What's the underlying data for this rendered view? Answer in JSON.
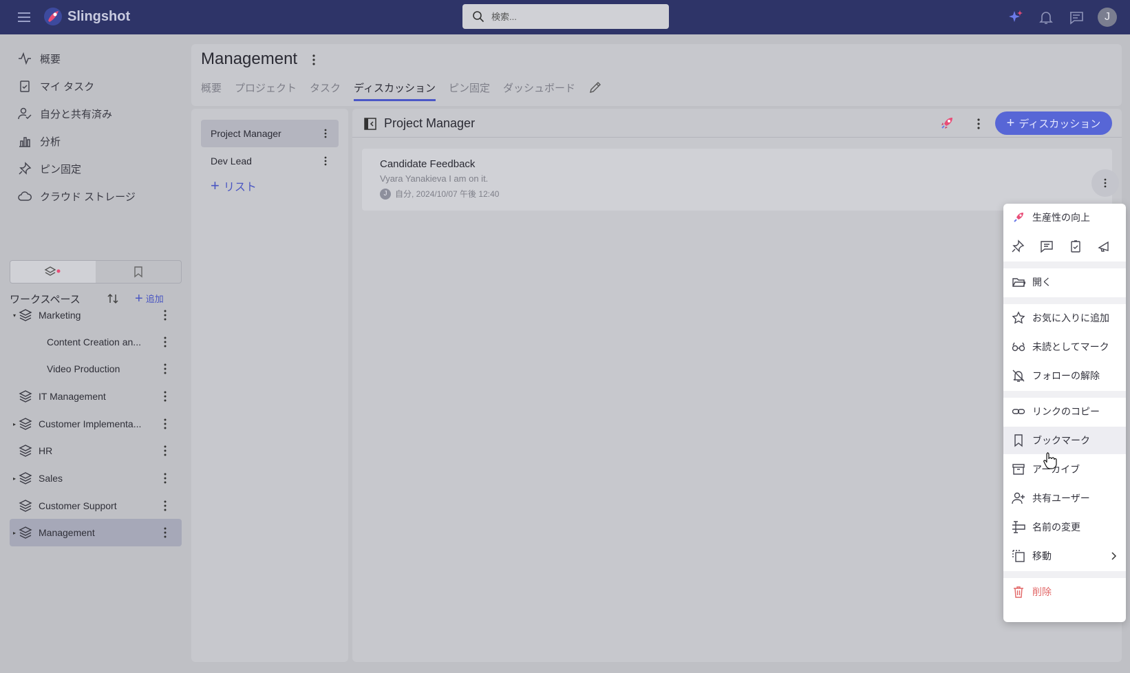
{
  "app": {
    "name": "Slingshot"
  },
  "topbar": {
    "search_placeholder": "検索...",
    "avatar_initial": "J",
    "icons": [
      "menu-icon",
      "sparkle-icon",
      "bell-icon",
      "chat-icon"
    ]
  },
  "nav": {
    "items": [
      {
        "label": "概要",
        "icon": "activity-icon"
      },
      {
        "label": "マイ タスク",
        "icon": "clipboard-check-icon"
      },
      {
        "label": "自分と共有済み",
        "icon": "user-check-icon"
      },
      {
        "label": "分析",
        "icon": "bar-chart-icon"
      },
      {
        "label": "ピン固定",
        "icon": "pin-icon"
      },
      {
        "label": "クラウド ストレージ",
        "icon": "cloud-icon"
      }
    ]
  },
  "workspace": {
    "title": "ワークスペース",
    "add_label": "追加",
    "items": [
      {
        "label": "Marketing",
        "caret": "▾",
        "child": false,
        "selected": false
      },
      {
        "label": "Content Creation an...",
        "caret": "",
        "child": true,
        "selected": false
      },
      {
        "label": "Video Production",
        "caret": "",
        "child": true,
        "selected": false
      },
      {
        "label": "IT Management",
        "caret": "",
        "child": false,
        "selected": false
      },
      {
        "label": "Customer Implementa...",
        "caret": "▸",
        "child": false,
        "selected": false
      },
      {
        "label": "HR",
        "caret": "",
        "child": false,
        "selected": false
      },
      {
        "label": "Sales",
        "caret": "▸",
        "child": false,
        "selected": false
      },
      {
        "label": "Customer Support",
        "caret": "",
        "child": false,
        "selected": false
      },
      {
        "label": "Management",
        "caret": "▸",
        "child": false,
        "selected": true
      }
    ]
  },
  "main": {
    "title": "Management",
    "tabs": [
      {
        "label": "概要",
        "active": false
      },
      {
        "label": "プロジェクト",
        "active": false
      },
      {
        "label": "タスク",
        "active": false
      },
      {
        "label": "ディスカッション",
        "active": true
      },
      {
        "label": "ピン固定",
        "active": false
      },
      {
        "label": "ダッシュボード",
        "active": false
      }
    ]
  },
  "lists": {
    "items": [
      {
        "label": "Project Manager",
        "selected": true
      },
      {
        "label": "Dev Lead",
        "selected": false
      }
    ],
    "add_label": "リスト"
  },
  "discussions": {
    "list_title": "Project Manager",
    "new_button_label": "ディスカッション",
    "cards": [
      {
        "title": "Candidate Feedback",
        "preview": "Vyara Yanakieva I am on it.",
        "avatar_initial": "J",
        "meta": "自分, 2024/10/07 午後 12:40"
      }
    ]
  },
  "context_menu": {
    "productivity_label": "生産性の向上",
    "quick_icons": [
      "pin-icon",
      "comment-icon",
      "task-icon",
      "megaphone-icon"
    ],
    "open_label": "開く",
    "favorite_label": "お気に入りに追加",
    "unread_label": "未読としてマーク",
    "unfollow_label": "フォローの解除",
    "copy_link_label": "リンクのコピー",
    "bookmark_label": "ブックマーク",
    "archive_label": "アーカイブ",
    "share_label": "共有ユーザー",
    "rename_label": "名前の変更",
    "move_label": "移動",
    "delete_label": "削除"
  },
  "colors": {
    "topbar": "#2e3468",
    "accent": "#5766d6",
    "danger": "#e26767"
  }
}
